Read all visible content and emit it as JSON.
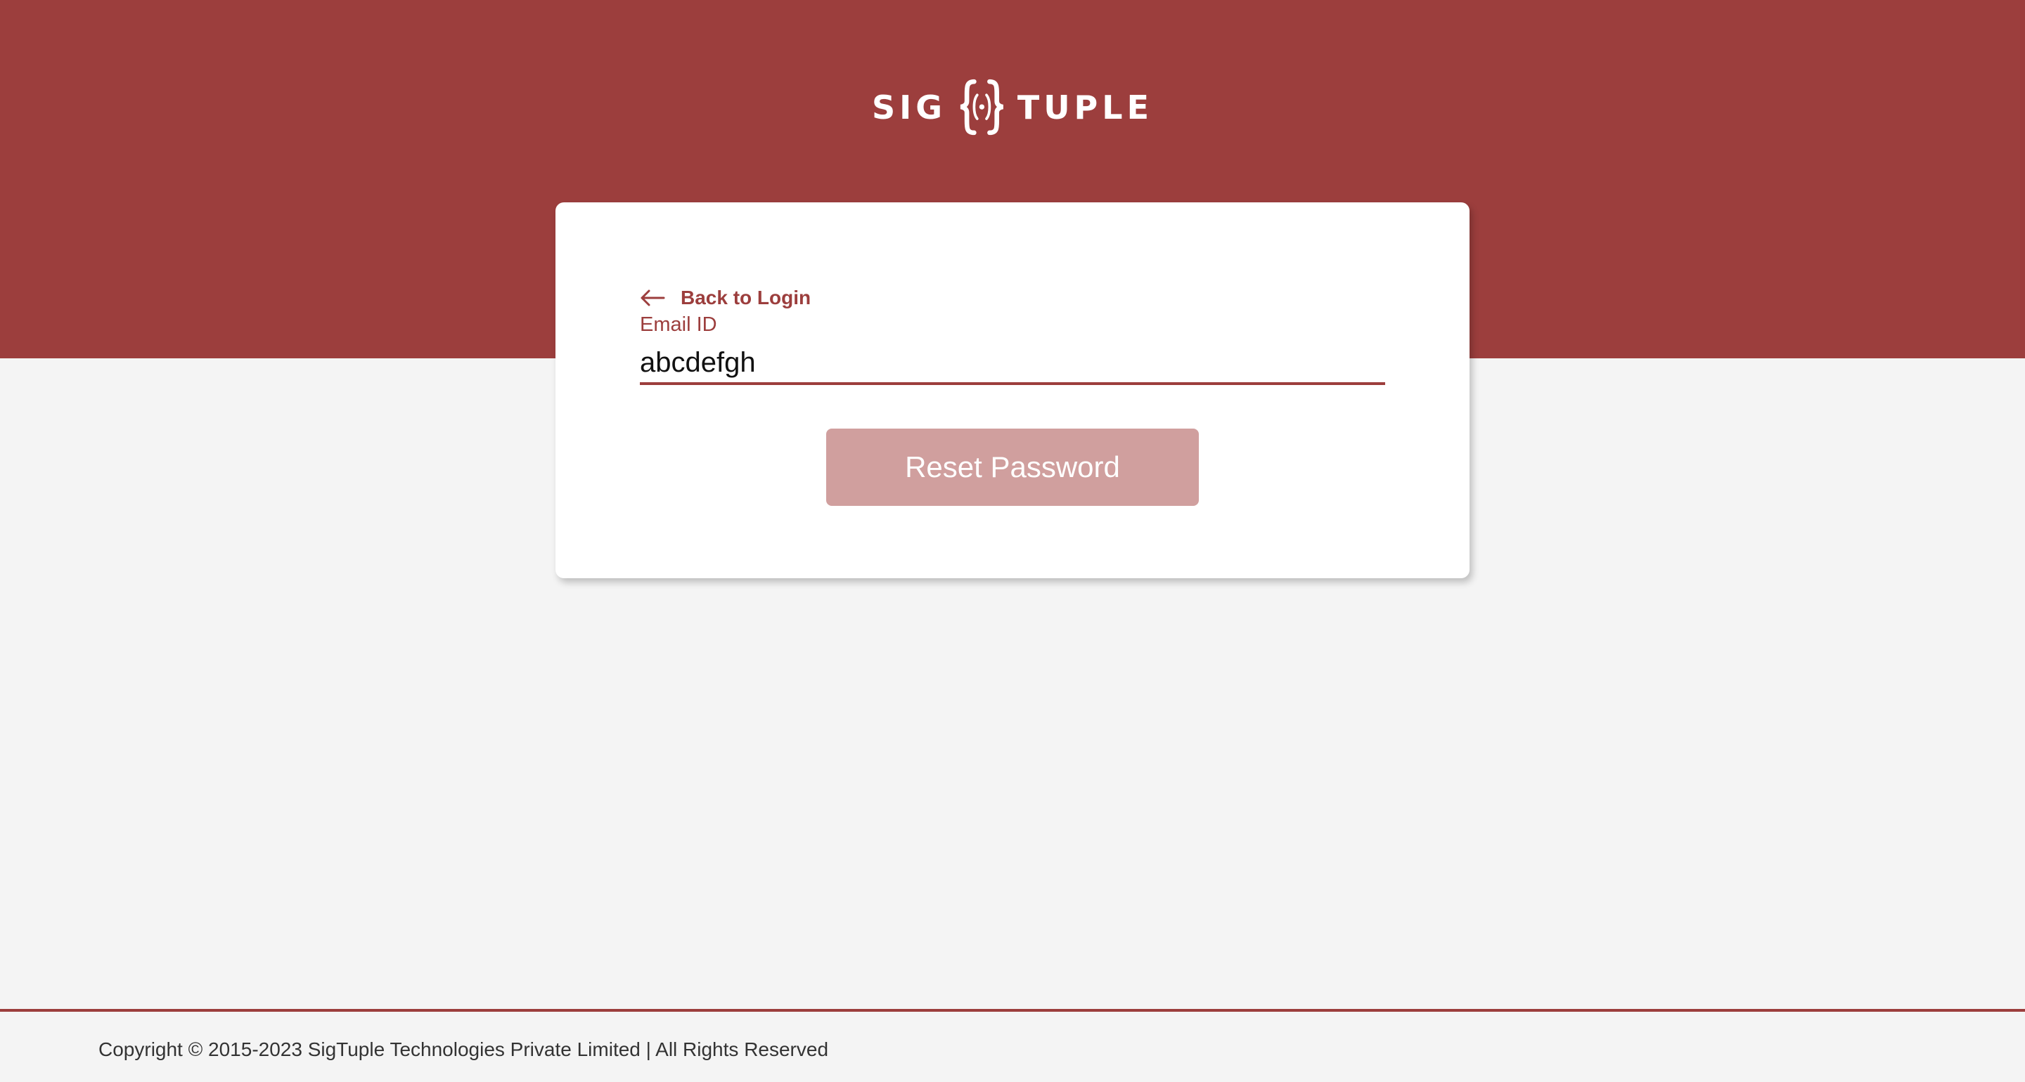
{
  "brand": {
    "name_left": "SIG",
    "name_right": "TUPLE",
    "logo_icon": "brace-dot-icon",
    "primary_color": "#9c3e3d",
    "button_color": "#d09f9e",
    "background_color": "#f4f4f4"
  },
  "card": {
    "back_link": {
      "label": "Back to Login",
      "icon": "arrow-left-icon"
    },
    "email_field": {
      "label": "Email ID",
      "value": "abcdefgh",
      "placeholder": ""
    },
    "reset_button": {
      "label": "Reset Password"
    }
  },
  "footer": {
    "copyright": "Copyright © 2015-2023 SigTuple Technologies Private Limited | All Rights Reserved"
  }
}
